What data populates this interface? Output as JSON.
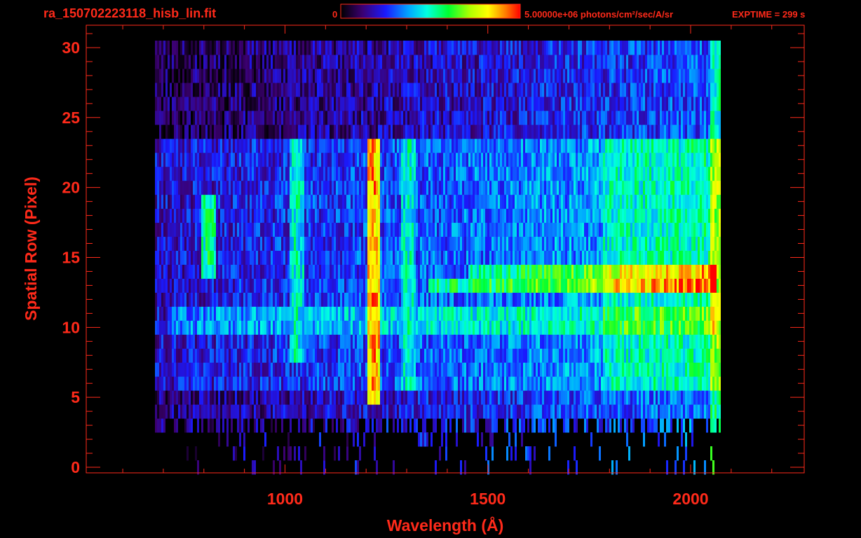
{
  "colors": {
    "axis": "#ff2a1a",
    "background": "#000000"
  },
  "chart_data": {
    "type": "heatmap",
    "title": "ra_150702223118_hisb_lin.fit",
    "colorbar": {
      "min_label": "0",
      "max_label": "5.00000e+06 photons/cm²/sec/A/sr",
      "colormap": "rainbow"
    },
    "exptime_label": "EXPTIME = 299 s",
    "xlabel": "Wavelength (Å)",
    "ylabel": "Spatial Row (Pixel)",
    "xlim": [
      510,
      2280
    ],
    "ylim": [
      -0.4,
      31.6
    ],
    "x_ticks": [
      1000,
      1500,
      2000
    ],
    "x_tick_labels": [
      "1000",
      "1500",
      "2000"
    ],
    "y_ticks": [
      0,
      5,
      10,
      15,
      20,
      25,
      30
    ],
    "y_tick_labels": [
      "0",
      "5",
      "10",
      "15",
      "20",
      "25",
      "30"
    ],
    "data_x_range": [
      680,
      2070
    ],
    "data_y_range": [
      0,
      30
    ],
    "spectral_features": [
      {
        "wavelength": 1216,
        "rows": [
          5,
          23
        ],
        "level": 0.9
      },
      {
        "wavelength": 1304,
        "rows": [
          6,
          23
        ],
        "level": 0.5
      },
      {
        "wavelength": 1026,
        "rows": [
          8,
          23
        ],
        "level": 0.5
      },
      {
        "wavelength": 810,
        "rows": [
          14,
          19
        ],
        "level": 0.55
      }
    ],
    "bright_rows": [
      {
        "row": 13,
        "wavelength_range": [
          1350,
          2060
        ],
        "level": 0.75
      },
      {
        "row": 14,
        "wavelength_range": [
          1450,
          2060
        ],
        "level": 0.7
      },
      {
        "row": 10,
        "wavelength_range": [
          720,
          2060
        ],
        "level": 0.45
      },
      {
        "row": 11,
        "wavelength_range": [
          720,
          2060
        ],
        "level": 0.45
      }
    ]
  }
}
